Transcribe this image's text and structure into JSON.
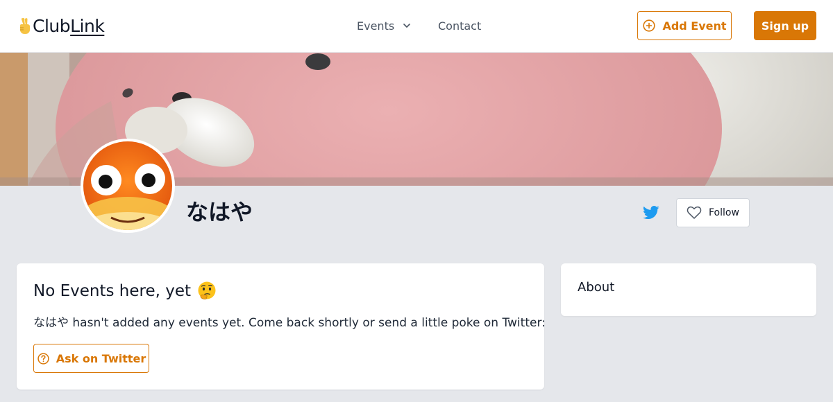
{
  "brand": {
    "logo_emoji": "victory-hand-icon",
    "name_part1": "Club",
    "name_part2": "Link"
  },
  "nav": {
    "events_label": "Events",
    "contact_label": "Contact"
  },
  "header_actions": {
    "add_event_label": "Add Event",
    "sign_up_label": "Sign up"
  },
  "colors": {
    "accent": "#d97706",
    "page_bg": "#e5e7eb",
    "twitter": "#1d9bf0"
  },
  "profile": {
    "name": "なはや",
    "follow_label": "Follow",
    "social_icon": "twitter-icon"
  },
  "events_card": {
    "title": "No Events here, yet",
    "title_emoji": "thinking-face-icon",
    "message": "なはや hasn't added any events yet. Come back shortly or send a little poke on Twitter:",
    "ask_button_label": "Ask on Twitter"
  },
  "about_card": {
    "title": "About"
  }
}
